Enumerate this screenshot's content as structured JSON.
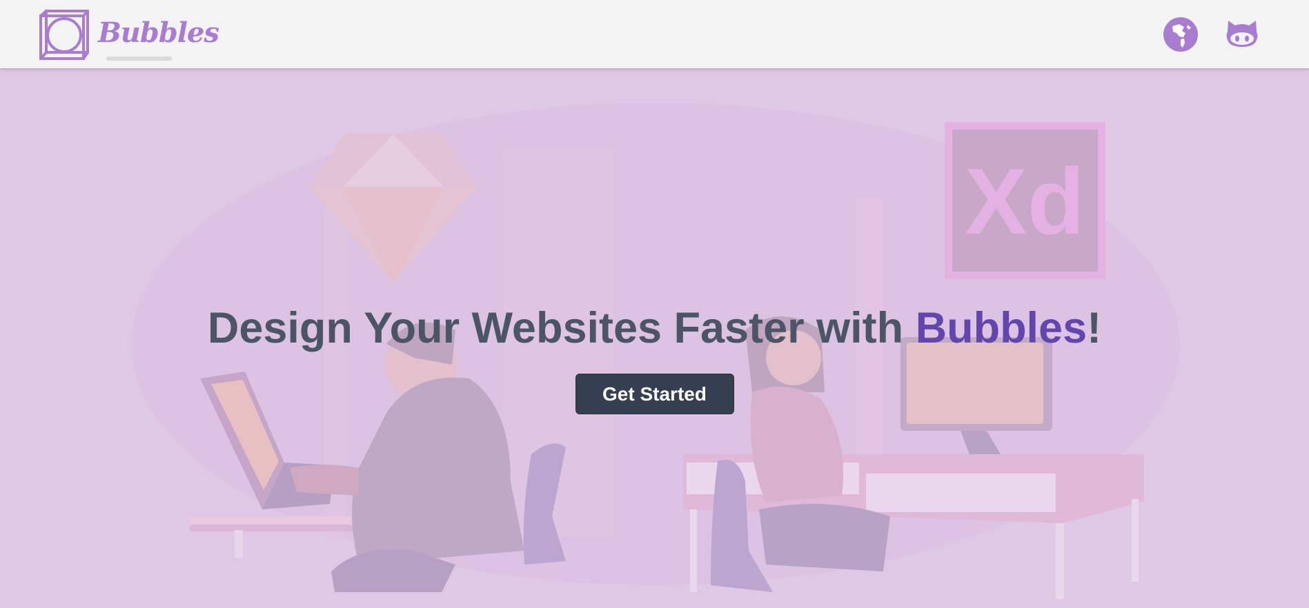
{
  "header": {
    "brand_name": "Bubbles",
    "brand_logo_icon": "cube-logo-icon",
    "actions": [
      {
        "icon": "globe-icon",
        "label": "Language"
      },
      {
        "icon": "github-icon",
        "label": "GitHub"
      }
    ]
  },
  "hero": {
    "title_prefix": "Design Your Websites Faster with ",
    "title_brand": "Bubbles",
    "title_suffix": "!",
    "cta_label": "Get Started"
  },
  "illustration": {
    "sketch_logo": "sketch-diamond-icon",
    "xd_logo_text": "Xd"
  },
  "colors": {
    "background": "#dfc8e6",
    "header_bg": "#f3f3f3",
    "accent": "#a87ccf",
    "brand_text": "#6346ad",
    "title_text": "#4b5565",
    "button_bg": "#363f4f"
  }
}
